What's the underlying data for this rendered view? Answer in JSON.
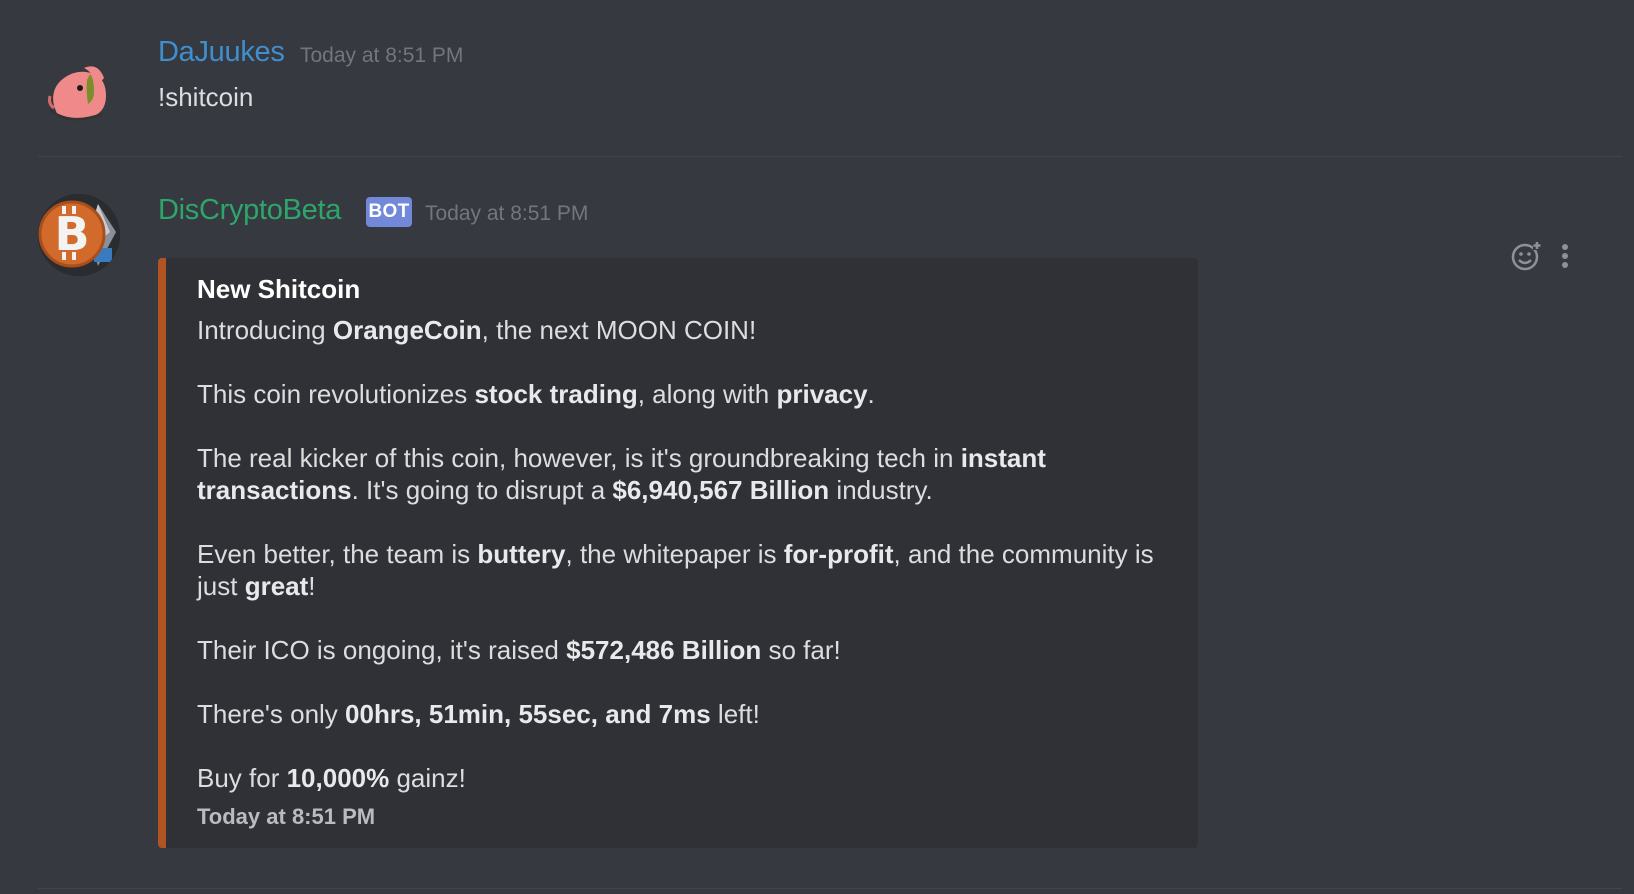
{
  "messages": [
    {
      "author": "DaJuukes",
      "author_color": "#3f8fcf",
      "timestamp": "Today at 8:51 PM",
      "text": "!shitcoin"
    },
    {
      "author": "DisCryptoBeta",
      "author_color": "#2ea56a",
      "badge": "BOT",
      "timestamp": "Today at 8:51 PM",
      "embed": {
        "color": "#b05522",
        "title": "New Shitcoin",
        "description": [
          [
            {
              "t": "Introducing "
            },
            {
              "t": "OrangeCoin",
              "b": true
            },
            {
              "t": ", the next MOON COIN!"
            }
          ],
          [
            {
              "t": "This coin revolutionizes "
            },
            {
              "t": "stock trading",
              "b": true
            },
            {
              "t": ", along with "
            },
            {
              "t": "privacy",
              "b": true
            },
            {
              "t": "."
            }
          ],
          [
            {
              "t": "The real kicker of this coin, however, is it's groundbreaking tech in "
            },
            {
              "t": "instant transactions",
              "b": true
            },
            {
              "t": ". It's going to disrupt a "
            },
            {
              "t": "$6,940,567 Billion",
              "b": true
            },
            {
              "t": " industry."
            }
          ],
          [
            {
              "t": "Even better, the team is "
            },
            {
              "t": "buttery",
              "b": true
            },
            {
              "t": ", the whitepaper is "
            },
            {
              "t": "for-profit",
              "b": true
            },
            {
              "t": ", and the community is just "
            },
            {
              "t": "great",
              "b": true
            },
            {
              "t": "!"
            }
          ],
          [
            {
              "t": "Their ICO is ongoing, it's raised "
            },
            {
              "t": "$572,486 Billion",
              "b": true
            },
            {
              "t": " so far!"
            }
          ],
          [
            {
              "t": "There's only "
            },
            {
              "t": "00hrs, 51min, 55sec, and 7ms",
              "b": true
            },
            {
              "t": " left!"
            }
          ],
          [
            {
              "t": "Buy for "
            },
            {
              "t": "10,000%",
              "b": true
            },
            {
              "t": " gainz!"
            }
          ]
        ],
        "footer": "Today at 8:51 PM"
      },
      "actions": [
        "add-reaction-icon",
        "more-options-icon"
      ]
    }
  ]
}
